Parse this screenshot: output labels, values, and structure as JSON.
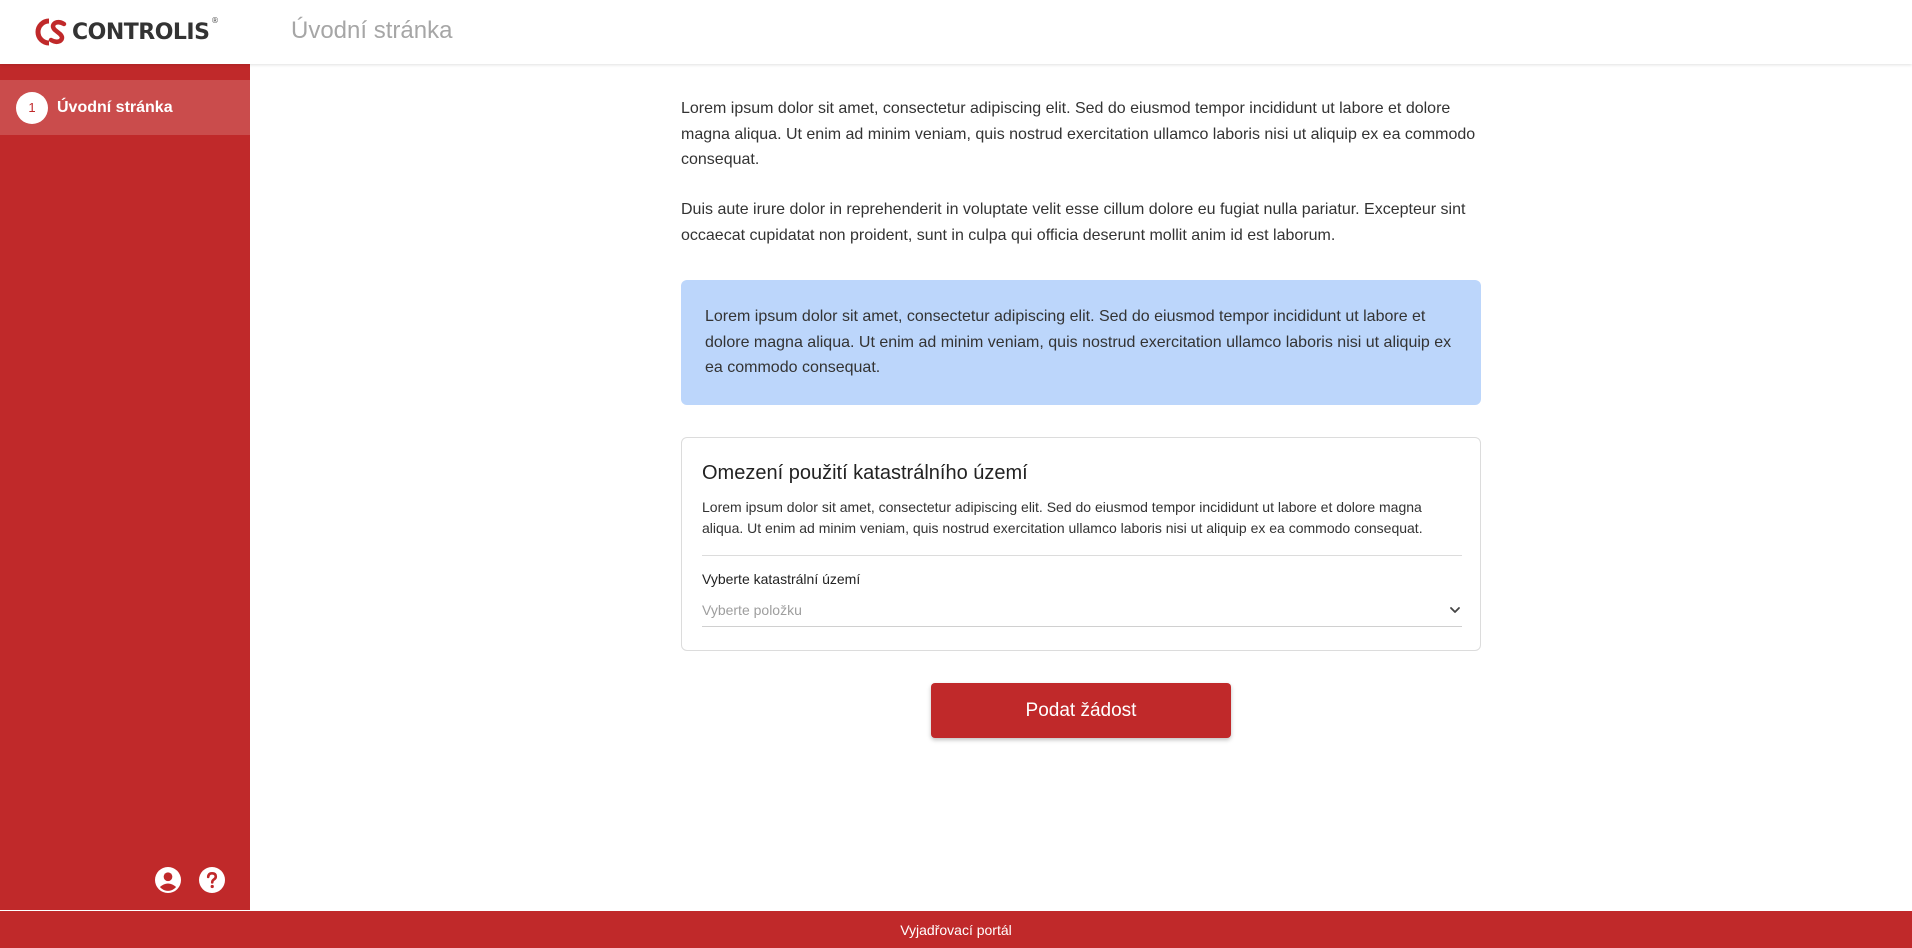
{
  "brand": {
    "name": "CONTROLIS",
    "registered_mark": "®",
    "color_primary": "#c0292a",
    "color_logo_text": "#333333"
  },
  "header": {
    "title": "Úvodní stránka"
  },
  "sidebar": {
    "items": [
      {
        "step": "1",
        "label": "Úvodní stránka",
        "active": true
      }
    ],
    "bottom_icons": [
      "account-circle-icon",
      "help-circle-icon"
    ]
  },
  "main": {
    "paragraph_1": "Lorem ipsum dolor sit amet, consectetur adipiscing elit. Sed do eiusmod tempor incididunt ut labore et dolore magna aliqua. Ut enim ad minim veniam, quis nostrud exercitation ullamco laboris nisi ut aliquip ex ea commodo consequat.",
    "paragraph_2": "Duis aute irure dolor in reprehenderit in voluptate velit esse cillum dolore eu fugiat nulla pariatur. Excepteur sint occaecat cupidatat non proident, sunt in culpa qui officia deserunt mollit anim id est laborum.",
    "info_box": {
      "text": "Lorem ipsum dolor sit amet, consectetur adipiscing elit. Sed do eiusmod tempor incididunt ut labore et dolore magna aliqua. Ut enim ad minim veniam, quis nostrud exercitation ullamco laboris nisi ut aliquip ex ea commodo consequat.",
      "color": "#bcd6fb"
    },
    "card": {
      "title": "Omezení použití katastrálního území",
      "description": "Lorem ipsum dolor sit amet, consectetur adipiscing elit. Sed do eiusmod tempor incididunt ut labore et dolore magna aliqua. Ut enim ad minim veniam, quis nostrud exercitation ullamco laboris nisi ut aliquip ex ea commodo consequat.",
      "select_label": "Vyberte katastrální území",
      "select_placeholder": "Vyberte položku"
    },
    "submit_label": "Podat žádost"
  },
  "footer": {
    "text": "Vyjadřovací portál"
  }
}
